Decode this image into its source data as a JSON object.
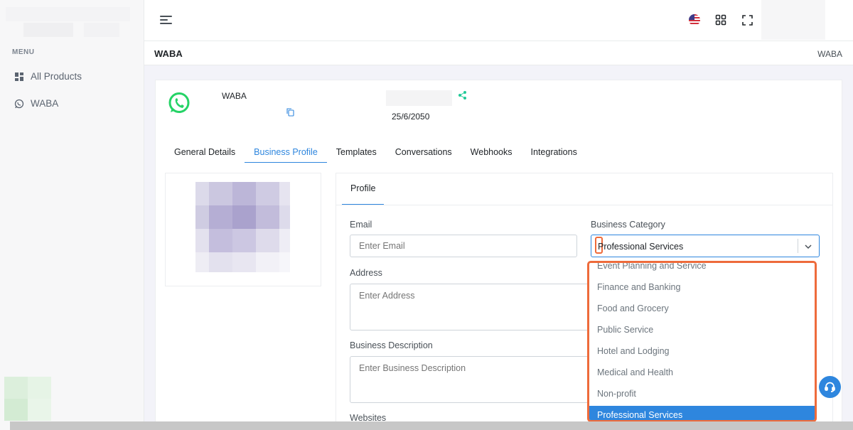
{
  "sidebar": {
    "menu_title": "MENU",
    "items": [
      {
        "label": "All Products",
        "icon": "grid-icon"
      },
      {
        "label": "WABA",
        "icon": "whatsapp-icon"
      }
    ]
  },
  "topbar": {
    "icons": [
      "hamburger-icon",
      "us-flag-icon",
      "apps-grid-icon",
      "fullscreen-icon"
    ]
  },
  "page": {
    "title": "WABA",
    "breadcrumb": "WABA"
  },
  "account": {
    "name": "WABA",
    "date": "25/6/2050"
  },
  "tabs": [
    {
      "label": "General Details",
      "active": false
    },
    {
      "label": "Business Profile",
      "active": true
    },
    {
      "label": "Templates",
      "active": false
    },
    {
      "label": "Conversations",
      "active": false
    },
    {
      "label": "Webhooks",
      "active": false
    },
    {
      "label": "Integrations",
      "active": false
    }
  ],
  "profile": {
    "tab_label": "Profile",
    "email": {
      "label": "Email",
      "placeholder": "Enter Email"
    },
    "address": {
      "label": "Address",
      "placeholder": "Enter Address"
    },
    "description": {
      "label": "Business Description",
      "placeholder": "Enter Business Description"
    },
    "websites": {
      "label": "Websites"
    },
    "category": {
      "label": "Business Category",
      "value": "Professional Services",
      "options": [
        "Event Planning and Service",
        "Finance and Banking",
        "Food and Grocery",
        "Public Service",
        "Hotel and Lodging",
        "Medical and Health",
        "Non-profit",
        "Professional Services"
      ]
    }
  },
  "colors": {
    "accent": "#2e86de",
    "highlight": "#ee6b3b",
    "whatsapp": "#25d366"
  }
}
